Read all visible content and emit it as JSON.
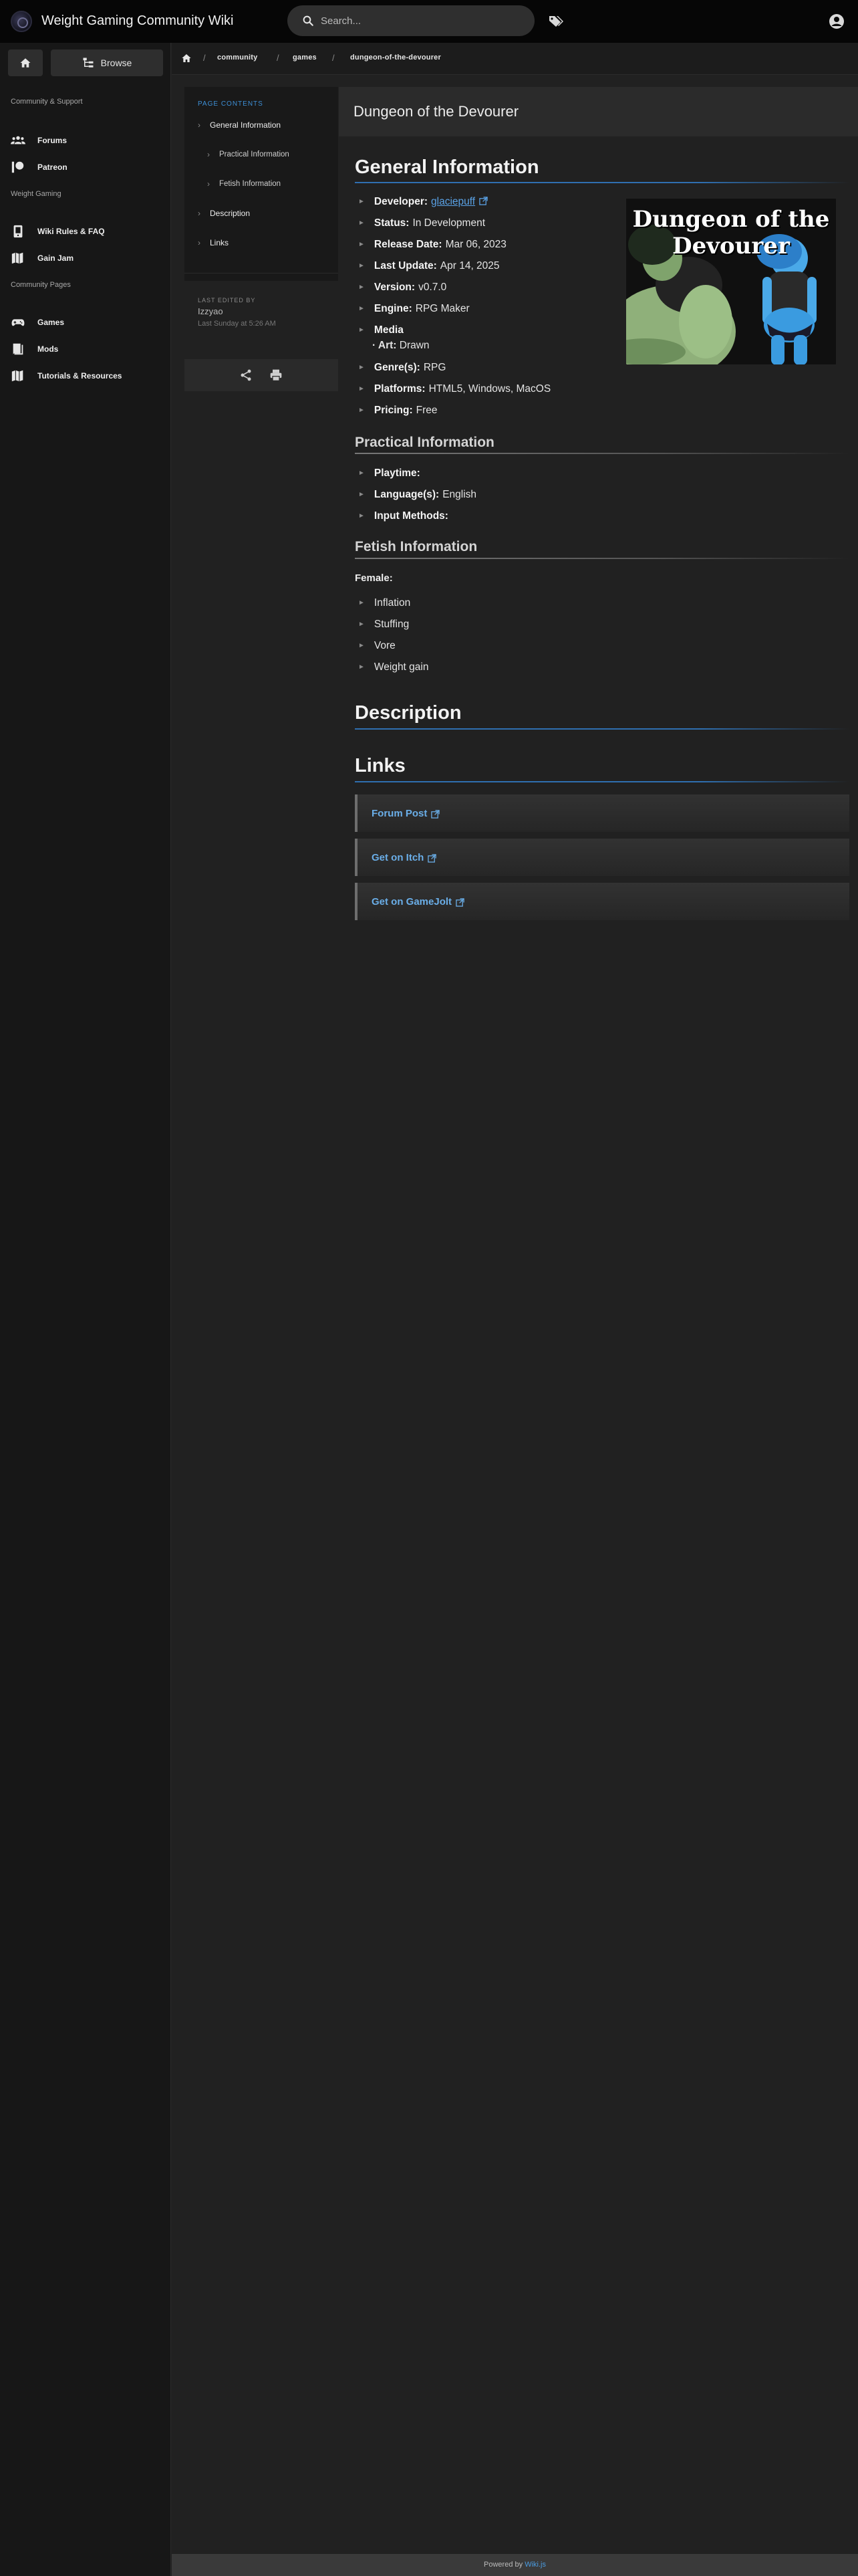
{
  "header": {
    "site_title": "Weight Gaming Community Wiki",
    "search_placeholder": "Search..."
  },
  "sidebar": {
    "browse_label": "Browse",
    "section_community": "Community & Support",
    "item_forums": "Forums",
    "item_patreon": "Patreon",
    "section_weight_gaming": "Weight Gaming",
    "item_rules": "Wiki Rules & FAQ",
    "item_gainjam": "Gain Jam",
    "section_community_pages": "Community Pages",
    "item_games": "Games",
    "item_mods": "Mods",
    "item_tutorials": "Tutorials & Resources"
  },
  "breadcrumb": [
    "community",
    "games",
    "dungeon-of-the-devourer"
  ],
  "toc": {
    "heading": "PAGE CONTENTS",
    "items": [
      "General Information",
      "Practical Information",
      "Fetish Information",
      "Description",
      "Links"
    ],
    "edited_label": "LAST EDITED BY",
    "edited_user": "Izzyao",
    "edited_time": "Last Sunday at 5:26 AM"
  },
  "page": {
    "title": "Dungeon of the Devourer",
    "cover_title": "Dungeon of the Devourer",
    "general": {
      "heading": "General Information",
      "developer_label": "Developer:",
      "developer_value": "glaciepuff",
      "status_label": "Status:",
      "status_value": "In Development",
      "release_label": "Release Date:",
      "release_value": "Mar 06, 2023",
      "update_label": "Last Update:",
      "update_value": "Apr 14, 2025",
      "version_label": "Version:",
      "version_value": "v0.7.0",
      "engine_label": "Engine:",
      "engine_value": "RPG Maker",
      "media_label": "Media",
      "art_label": "· Art:",
      "art_value": "Drawn",
      "genre_label": "Genre(s):",
      "genre_value": "RPG",
      "platforms_label": "Platforms:",
      "platforms_value": "HTML5, Windows, MacOS",
      "pricing_label": "Pricing:",
      "pricing_value": "Free"
    },
    "practical": {
      "heading": "Practical Information",
      "playtime_label": "Playtime:",
      "language_label": "Language(s):",
      "language_value": "English",
      "input_label": "Input Methods:"
    },
    "fetish": {
      "heading": "Fetish Information",
      "female_label": "Female:",
      "items": [
        "Inflation",
        "Stuffing",
        "Vore",
        "Weight gain"
      ]
    },
    "description_heading": "Description",
    "links_heading": "Links",
    "links": [
      "Forum Post",
      "Get on Itch",
      "Get on GameJolt"
    ]
  },
  "footer": {
    "prefix": "Powered by",
    "brand": "Wiki.js"
  }
}
